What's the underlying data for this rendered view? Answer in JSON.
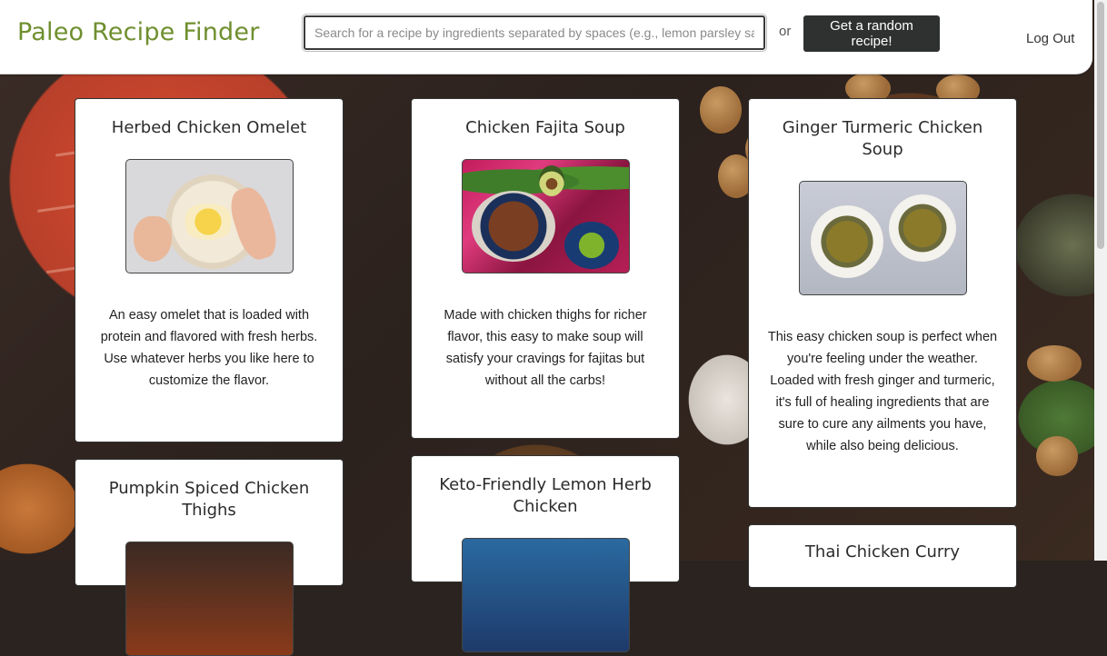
{
  "header": {
    "logo": "Paleo Recipe Finder",
    "search_placeholder": "Search for a recipe by ingredients separated by spaces (e.g., lemon parsley salmon)",
    "search_value": "",
    "or_text": "or",
    "random_button": "Get a random recipe!",
    "logout": "Log Out"
  },
  "recipes": [
    {
      "title": "Herbed Chicken Omelet",
      "description": "An easy omelet that is loaded with protein and flavored with fresh herbs. Use whatever herbs you like here to customize the flavor."
    },
    {
      "title": "Chicken Fajita Soup",
      "description": "Made with chicken thighs for richer flavor, this easy to make soup will satisfy your cravings for fajitas but without all the carbs!"
    },
    {
      "title": "Ginger Turmeric Chicken Soup",
      "description": "This easy chicken soup is perfect when you're feeling under the weather. Loaded with fresh ginger and turmeric, it's full of healing ingredients that are sure to cure any ailments you have, while also being delicious."
    },
    {
      "title": "Pumpkin Spiced Chicken Thighs",
      "description": ""
    },
    {
      "title": "Keto-Friendly Lemon Herb Chicken",
      "description": ""
    },
    {
      "title": "Thai Chicken Curry",
      "description": ""
    }
  ]
}
